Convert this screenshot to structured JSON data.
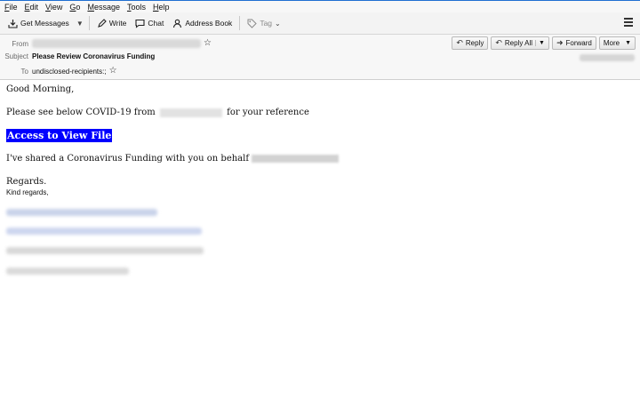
{
  "menu": [
    {
      "label": "File",
      "accel": "F",
      "rest": "ile"
    },
    {
      "label": "Edit",
      "accel": "E",
      "rest": "dit"
    },
    {
      "label": "View",
      "accel": "V",
      "rest": "iew"
    },
    {
      "label": "Go",
      "accel": "G",
      "rest": "o"
    },
    {
      "label": "Message",
      "accel": "M",
      "rest": "essage"
    },
    {
      "label": "Tools",
      "accel": "T",
      "rest": "ools"
    },
    {
      "label": "Help",
      "accel": "H",
      "rest": "elp"
    }
  ],
  "toolbar": {
    "get_messages": "Get Messages",
    "write": "Write",
    "chat": "Chat",
    "address_book": "Address Book",
    "tag": "Tag"
  },
  "header": {
    "from_label": "From",
    "subject_label": "Subject",
    "subject": "Please Review Coronavirus Funding",
    "to_label": "To",
    "to": "undisclosed-recipients:;",
    "buttons": {
      "reply": "Reply",
      "reply_all": "Reply All",
      "forward": "Forward",
      "more": "More"
    }
  },
  "body": {
    "greeting": "Good Morning,",
    "line2_start": "Please see below COVID-19 from",
    "line2_end": "for your reference",
    "link": "Access to View File",
    "line4": "I've shared a Coronavirus Funding with you on behalf",
    "regards": "Regards.",
    "kind_regards": "Kind regards,"
  },
  "colors": {
    "link_highlight": "#0000ff",
    "accent_border": "#1f6fd1"
  },
  "icons": [
    "get-messages-icon",
    "write-icon",
    "chat-icon",
    "address-book-icon",
    "tag-icon",
    "reply-icon",
    "reply-all-icon",
    "forward-icon",
    "star-icon",
    "menu-icon"
  ]
}
